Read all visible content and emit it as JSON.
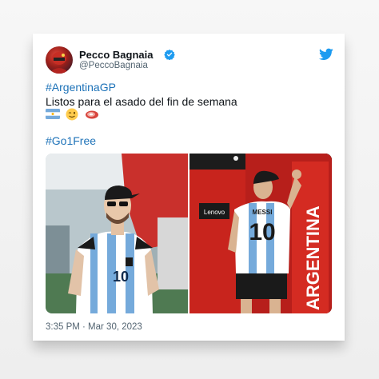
{
  "author": {
    "display_name": "Pecco Bagnaia",
    "handle": "@PeccoBagnaia"
  },
  "tweet": {
    "hashtag_line": "#ArgentinaGP",
    "text_line": "Listos para el asado del fin de semana",
    "emojis": [
      "argentina-flag-emoji",
      "winking-face-emoji",
      "meat-emoji"
    ],
    "hashtag_line_2": "#Go1Free",
    "timestamp": "3:35 PM · Mar 30, 2023"
  },
  "photos": {
    "right_banner_text": "ARGENTINA",
    "right_sign_text": "Lenovo",
    "jersey_name": "MESSI",
    "jersey_number": "10",
    "left_jersey_number": "10"
  },
  "colors": {
    "twitter_blue": "#1d9bf0",
    "link_blue": "#1d72b8",
    "argentina_sky": "#75aadb"
  }
}
